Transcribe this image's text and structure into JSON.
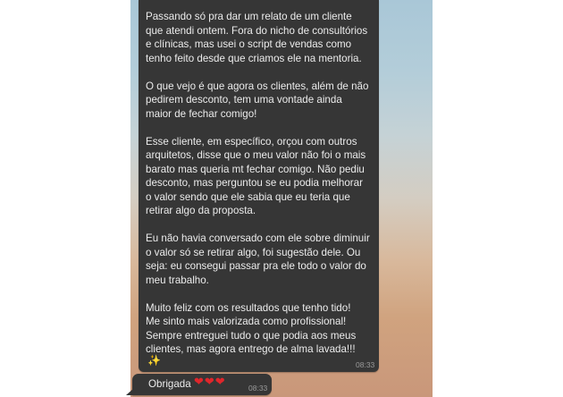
{
  "chat": {
    "message": {
      "text": "Passando só pra dar um relato de um cliente\nque atendi ontem. Fora do nicho de consultórios\ne clínicas, mas usei o script de vendas como\ntenho feito desde que criamos ele na mentoria.\n\nO que vejo é que agora os clientes, além de não\npedirem desconto, tem uma vontade ainda\nmaior de fechar comigo!\n\nEsse cliente, em específico, orçou com outros\narquitetos, disse que o meu valor não foi o mais\nbarato mas queria mt fechar comigo. Não pediu\ndesconto, mas perguntou se eu podia melhorar\no valor sendo que ele sabia que eu teria que\nretirar algo da proposta.\n\nEu não havia conversado com ele sobre diminuir\no valor só se retirar algo, foi sugestão dele. Ou\nseja: eu consegui passar pra ele todo o valor do\nmeu trabalho.\n\nMuito feliz com os resultados que tenho tido!\nMe sinto mais valorizada como profissional!\nSempre entreguei tudo o que podia aos meus\nclientes, mas agora entrego de alma lavada!!!",
      "emoji": "✨",
      "time": "08:33"
    },
    "reply": {
      "text": "Obrigada",
      "emoji": "❤❤❤",
      "time": "08:33"
    }
  }
}
